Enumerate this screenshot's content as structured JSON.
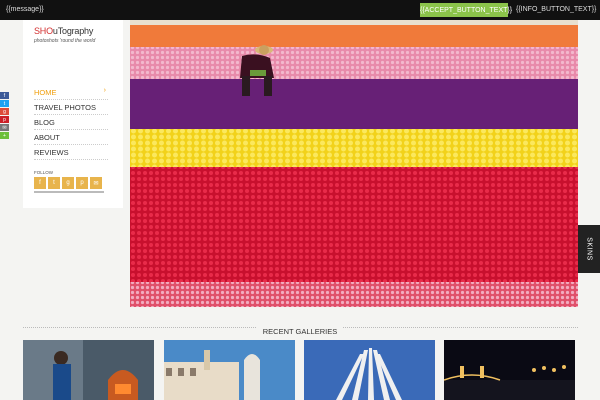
{
  "cookie_bar": {
    "message": "{{message}}",
    "accept_label": "{{ACCEPT_BUTTON_TEXT}}",
    "info_label": "{{INFO_BUTTON_TEXT}}"
  },
  "logo": {
    "part1": "SHO",
    "part2": "u",
    "part3": "Tography",
    "tagline": "photoshots 'round the world"
  },
  "nav": {
    "items": [
      {
        "label": "HOME",
        "active": true
      },
      {
        "label": "TRAVEL PHOTOS",
        "active": false
      },
      {
        "label": "BLOG",
        "active": false
      },
      {
        "label": "ABOUT",
        "active": false
      },
      {
        "label": "REVIEWS",
        "active": false
      }
    ]
  },
  "follow": {
    "label": "FOLLOW",
    "icons": [
      "facebook-icon",
      "twitter-icon",
      "google-plus-icon",
      "pinterest-icon",
      "email-icon"
    ]
  },
  "share_strip": {
    "icons": [
      "facebook-icon",
      "twitter-icon",
      "google-plus-icon",
      "pinterest-icon",
      "email-icon",
      "share-icon"
    ],
    "colors": [
      "#3b5998",
      "#1da1f2",
      "#dd4b39",
      "#cb2027",
      "#777777",
      "#6cbf3a"
    ]
  },
  "skins_tab": {
    "label": "SKINS"
  },
  "recent": {
    "title": "RECENT GALLERIES"
  },
  "colors": {
    "accent": "#f0a010",
    "accept_button": "#8bc34a",
    "logo_red": "#d32f2f"
  }
}
